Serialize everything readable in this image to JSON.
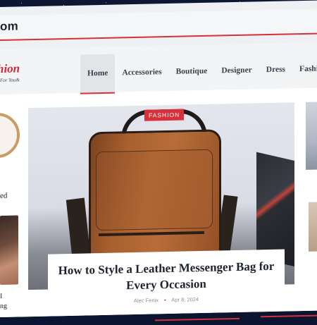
{
  "browser": {
    "url": "om"
  },
  "site": {
    "logo_main": "hion",
    "logo_sub": "For You&",
    "nav": [
      "Home",
      "Accessories",
      "Boutique",
      "Designer",
      "Dress",
      "Fashion"
    ],
    "nav_active_index": 0
  },
  "left": {
    "word1": "ed",
    "word2_lines": [
      "I",
      "ng"
    ]
  },
  "hero": {
    "badge": "FASHION",
    "title": "How to Style a Leather Messenger Bag for Every Occasion",
    "author": "Alec Fenix",
    "date": "Apr 8, 2024"
  },
  "colors": {
    "accent": "#d8303a",
    "dark": "#1f2330"
  }
}
